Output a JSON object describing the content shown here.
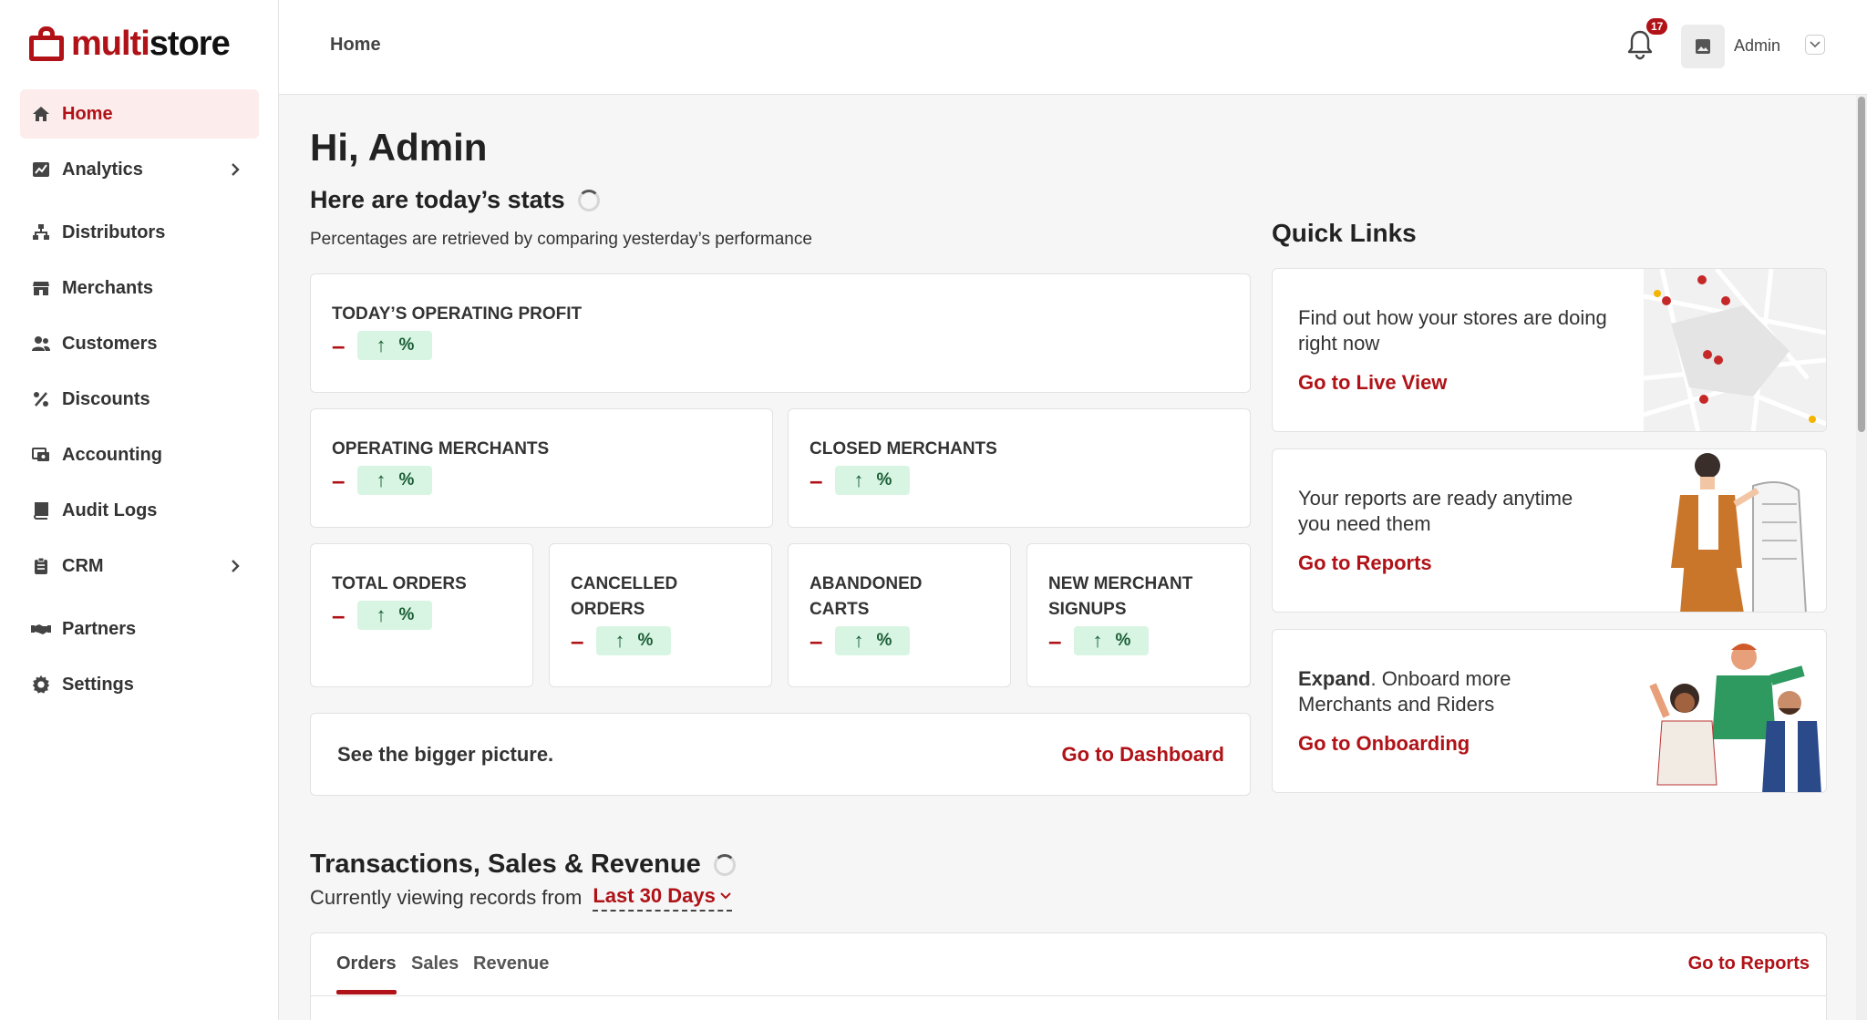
{
  "brand": {
    "name_part1": "multi",
    "name_part2": "store",
    "accent": "#b01217"
  },
  "sidebar": {
    "items": [
      {
        "label": "Home",
        "icon": "home-icon",
        "active": true
      },
      {
        "label": "Analytics",
        "icon": "analytics-icon",
        "expandable": true
      },
      {
        "label": "Distributors",
        "icon": "distributors-icon"
      },
      {
        "label": "Merchants",
        "icon": "store-icon"
      },
      {
        "label": "Customers",
        "icon": "customers-icon"
      },
      {
        "label": "Discounts",
        "icon": "percent-icon"
      },
      {
        "label": "Accounting",
        "icon": "accounting-icon"
      },
      {
        "label": "Audit Logs",
        "icon": "book-icon"
      },
      {
        "label": "CRM",
        "icon": "clipboard-icon",
        "expandable": true
      },
      {
        "label": "Partners",
        "icon": "handshake-icon"
      },
      {
        "label": "Settings",
        "icon": "gear-icon"
      }
    ]
  },
  "header": {
    "breadcrumb": "Home",
    "notification_count": "17",
    "user_name": "Admin"
  },
  "main": {
    "greeting": "Hi, Admin",
    "stats_title": "Here are today’s stats",
    "stats_subtitle": "Percentages are retrieved by comparing yesterday’s performance",
    "cards": {
      "operating_profit": {
        "title": "Today’s operating profit",
        "value": "–",
        "change": "%"
      },
      "operating_merchants": {
        "title": "Operating merchants",
        "value": "–",
        "change": "%"
      },
      "closed_merchants": {
        "title": "Closed merchants",
        "value": "–",
        "change": "%"
      },
      "total_orders": {
        "title": "Total orders",
        "value": "–",
        "change": "%"
      },
      "cancelled_orders": {
        "title": "Cancelled orders",
        "value": "–",
        "change": "%"
      },
      "abandoned_carts": {
        "title": "Abandoned carts",
        "value": "–",
        "change": "%"
      },
      "new_merchant_signups": {
        "title": "New merchant signups",
        "value": "–",
        "change": "%"
      }
    },
    "bigger_picture": {
      "text": "See the bigger picture.",
      "link": "Go to Dashboard"
    },
    "quick_links": {
      "title": "Quick Links",
      "live_view": {
        "text": "Find out how your stores are doing right now",
        "link": "Go to Live View"
      },
      "reports": {
        "text": "Your reports are ready anytime you need them",
        "link": "Go to Reports"
      },
      "onboarding": {
        "bold": "Expand",
        "text": ". Onboard more Merchants and Riders",
        "link": "Go to Onboarding"
      }
    },
    "transactions": {
      "title": "Transactions, Sales & Revenue",
      "subtitle": "Currently viewing records from",
      "range": "Last 30 Days",
      "tabs": [
        "Orders",
        "Sales",
        "Revenue"
      ],
      "active_tab": "Orders",
      "reports_link": "Go to Reports"
    }
  }
}
